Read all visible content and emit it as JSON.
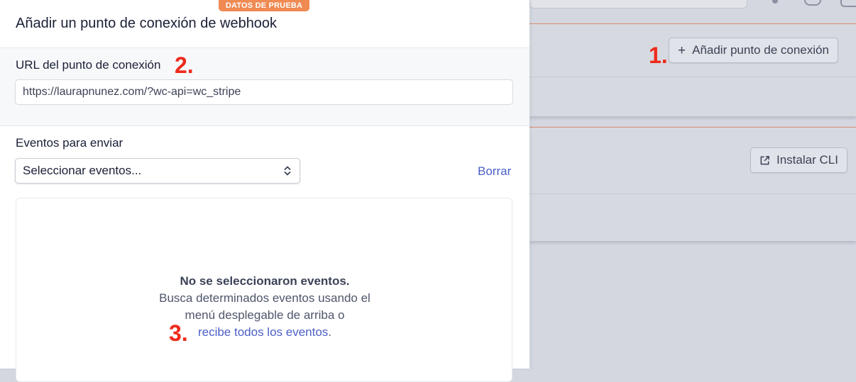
{
  "drawer": {
    "test_badge": "DATOS DE PRUEBA",
    "title": "Añadir un punto de conexión de webhook",
    "url_label": "URL del punto de conexión",
    "url_value": "https://laurapnunez.com/?wc-api=wc_stripe",
    "events_label": "Eventos para enviar",
    "select_placeholder": "Seleccionar eventos...",
    "clear_label": "Borrar",
    "empty_state": {
      "title": "No se seleccionaron eventos.",
      "line1": "Busca determinados eventos usando el",
      "line2": "menú desplegable de arriba o",
      "link": "recibe todos los eventos",
      "link_suffix": "."
    }
  },
  "background": {
    "add_endpoint_label": "Añadir punto de conexión",
    "install_cli_label": "Instalar CLI"
  },
  "annotations": {
    "one": "1.",
    "two": "2.",
    "three": "3."
  },
  "icons": {
    "plus": "plus-icon",
    "external_link": "external-link-icon",
    "select_arrows": "chevron-up-down-icon"
  },
  "colors": {
    "test_badge": "#ef8a52",
    "link": "#4b5fc6",
    "annotation": "#ee2a1b",
    "overlay": "#d4d7df"
  }
}
